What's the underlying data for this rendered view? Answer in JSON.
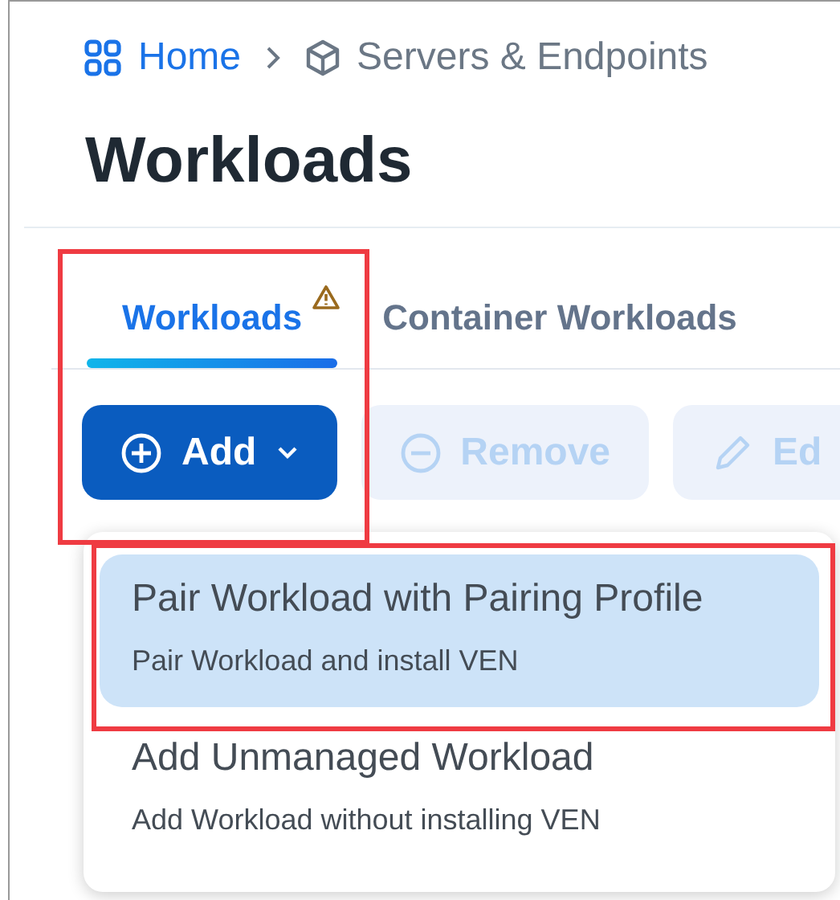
{
  "breadcrumb": [
    {
      "label": "Home",
      "kind": "home"
    },
    {
      "label": "Servers & Endpoints",
      "kind": "cube"
    }
  ],
  "title": "Workloads",
  "tabs": [
    {
      "label": "Workloads",
      "selected": true,
      "warning": true
    },
    {
      "label": "Container Workloads",
      "selected": false,
      "warning": false
    }
  ],
  "toolbar": [
    {
      "label": "Add",
      "kind": "add",
      "disabled": false
    },
    {
      "label": "Remove",
      "kind": "remove",
      "disabled": true
    },
    {
      "label": "Ed",
      "kind": "edit",
      "disabled": true
    }
  ],
  "menu": [
    {
      "title": "Pair Workload with Pairing Profile",
      "description": "Pair Workload and install VEN",
      "selected": true
    },
    {
      "title": "Add Unmanaged Workload",
      "description": "Add Workload without installing VEN",
      "selected": false
    }
  ],
  "highlight_frames": {
    "around_tab_and_add_button": true,
    "around_first_menu_item": true
  }
}
